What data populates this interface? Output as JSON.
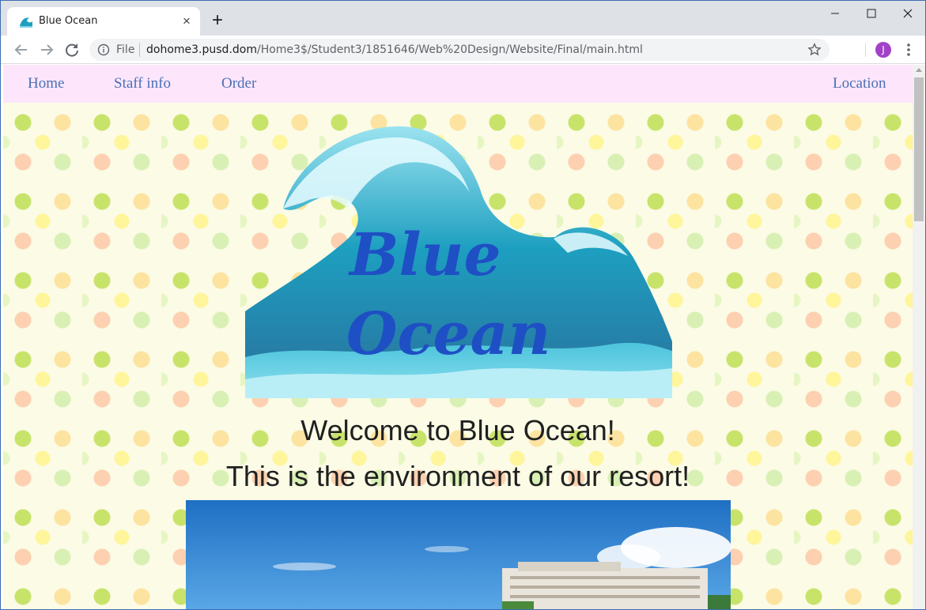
{
  "browser": {
    "tab_title": "Blue Ocean",
    "tab_close": "×",
    "new_tab": "+",
    "file_label": "File",
    "url_host": "dohome3.pusd.dom",
    "url_path": "/Home3$/Student3/1851646/Web%20Design/Website/Final/main.html",
    "profile_initial": "J"
  },
  "site": {
    "nav": {
      "home": "Home",
      "staff": "Staff info",
      "order": "Order",
      "location": "Location"
    },
    "logo": {
      "line1": "Blue",
      "line2": "Ocean"
    },
    "welcome_1": "Welcome to Blue Ocean!",
    "welcome_2": "This is the environment of our resort!"
  },
  "colors": {
    "nav_bg": "#fde6fb",
    "nav_link": "#4a6fb5",
    "logo_text": "#1f4fc4",
    "wave": "#1d9fc0",
    "avatar": "#a142c9"
  }
}
